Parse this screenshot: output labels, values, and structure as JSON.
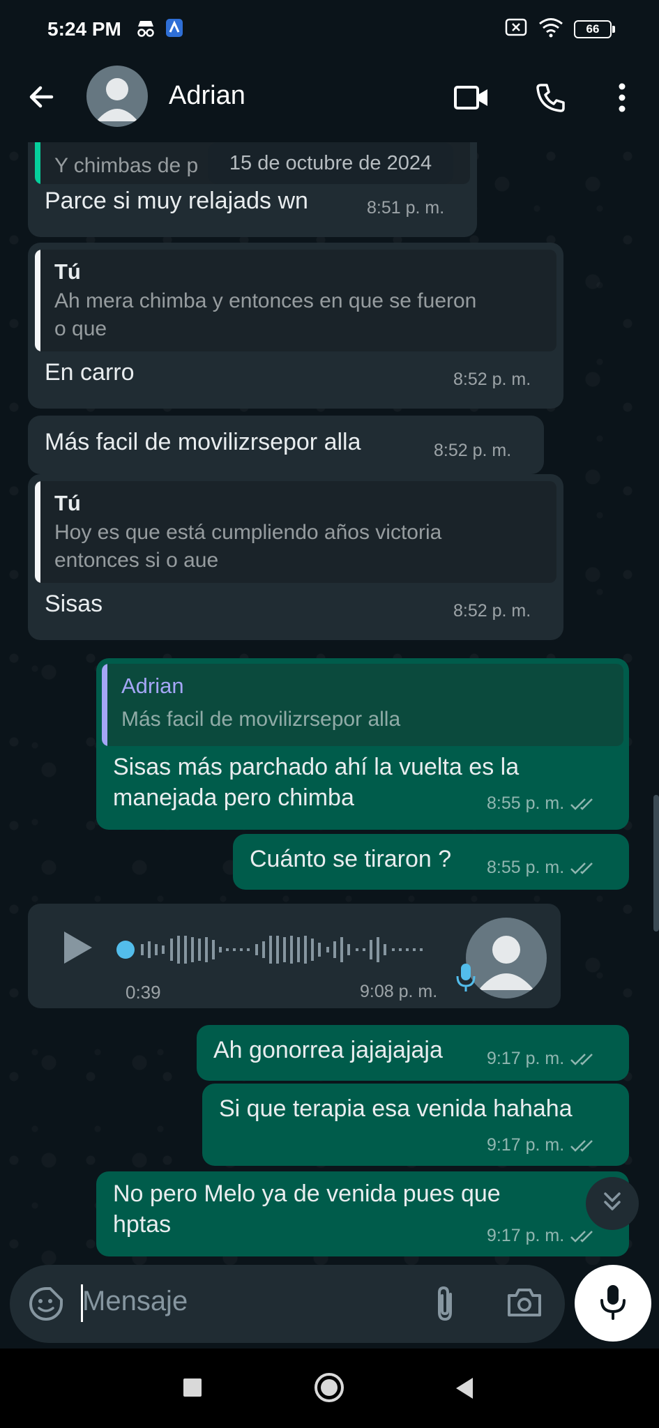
{
  "status_bar": {
    "time": "5:24 PM",
    "battery": "66"
  },
  "header": {
    "contact_name": "Adrian"
  },
  "date_chip": "15 de octubre de 2024",
  "messages": [
    {
      "dir": "in",
      "quote": {
        "author": "",
        "text": "Y chimbas de p"
      },
      "text": "Parce si muy relajads wn",
      "time": "8:51 p. m."
    },
    {
      "dir": "in",
      "quote": {
        "author": "Tú",
        "text": [
          "Ah mera chimba y entonces en que se fueron",
          "o que"
        ]
      },
      "text": "En carro",
      "time": "8:52 p. m."
    },
    {
      "dir": "in",
      "text": "Más facil de movilizrsepor alla",
      "time": "8:52 p. m."
    },
    {
      "dir": "in",
      "quote": {
        "author": "Tú",
        "text": [
          "Hoy es que está cumpliendo años victoria",
          "entonces si o aue"
        ]
      },
      "text": "Sisas",
      "time": "8:52 p. m."
    },
    {
      "dir": "out",
      "quote": {
        "author": "Adrian",
        "text": "Más facil de movilizrsepor alla"
      },
      "text": [
        "Sisas más parchado ahí la vuelta es la",
        "manejada pero chimba"
      ],
      "time": "8:55 p. m."
    },
    {
      "dir": "out",
      "text": "Cuánto se tiraron ?",
      "time": "8:55 p. m."
    },
    {
      "dir": "in",
      "type": "voice",
      "duration": "0:39",
      "time": "9:08 p. m."
    },
    {
      "dir": "out",
      "text": "Ah gonorrea jajajajaja",
      "time": "9:17 p. m."
    },
    {
      "dir": "out",
      "text": "Si que terapia esa venida hahaha",
      "time": "9:17 p. m."
    },
    {
      "dir": "out",
      "text": [
        "No pero Melo ya de venida pues que",
        "hptas"
      ],
      "time": "9:17 p. m."
    }
  ],
  "composer": {
    "placeholder": "Mensaje"
  },
  "colors": {
    "incoming": "#202c33",
    "outgoing": "#005c4b",
    "quote_you": "#06cf9c",
    "quote_adrian": "#a5a6f6",
    "voice_dot": "#53bdeb"
  }
}
